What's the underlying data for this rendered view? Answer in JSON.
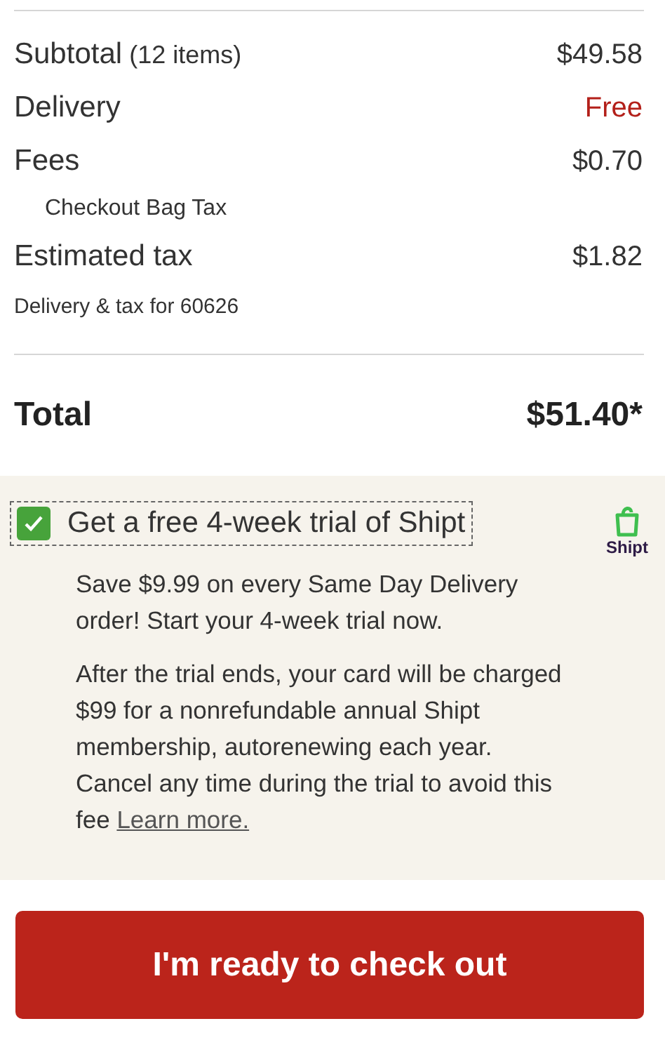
{
  "summary": [
    {
      "kind": "line",
      "label": "Subtotal",
      "count": "(12 items)",
      "value": "$49.58",
      "promo": false
    },
    {
      "kind": "line",
      "label": "Delivery",
      "value": "Free",
      "promo": true
    },
    {
      "kind": "line",
      "label": "Fees",
      "value": "$0.70",
      "promo": false
    },
    {
      "kind": "subline",
      "label": "Checkout Bag Tax"
    },
    {
      "kind": "line",
      "label": "Estimated tax",
      "value": "$1.82",
      "promo": false
    },
    {
      "kind": "note",
      "label": "Delivery & tax for 60626"
    }
  ],
  "total": {
    "label": "Total",
    "value": "$51.40*"
  },
  "offer": {
    "checked": true,
    "label": "Get a free 4-week trial of Shipt",
    "logo_text": "Shipt",
    "paragraphs": [
      "Save $9.99 on every Same Day Delivery order! Start your 4-week trial now.",
      "After the trial ends, your card will be charged $99 for a nonrefundable annual Shipt membership, autorenewing each year. Cancel any time during the trial to avoid this fee"
    ],
    "link": "Learn more."
  },
  "checkout_button": "I'm ready to check out"
}
